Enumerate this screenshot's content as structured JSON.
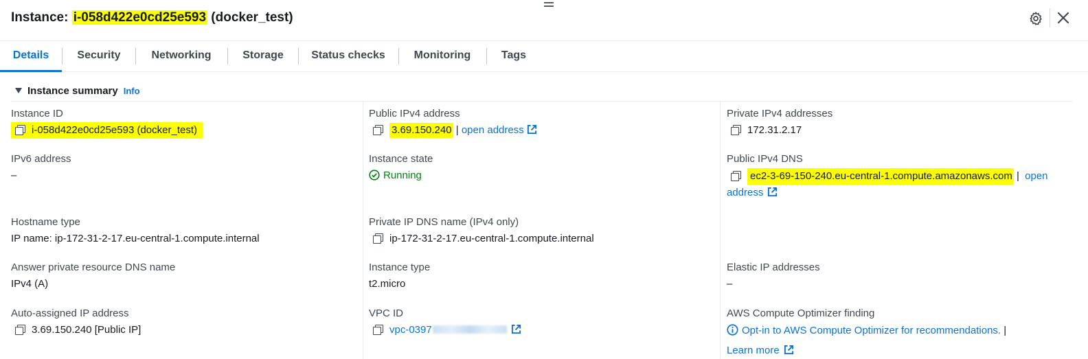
{
  "header": {
    "title_prefix": "Instance: ",
    "instance_id": "i-058d422e0cd25e593",
    "instance_name": " (docker_test)"
  },
  "tabs": [
    {
      "label": "Details",
      "active": true
    },
    {
      "label": "Security"
    },
    {
      "label": "Networking"
    },
    {
      "label": "Storage"
    },
    {
      "label": "Status checks"
    },
    {
      "label": "Monitoring"
    },
    {
      "label": "Tags"
    }
  ],
  "summary": {
    "heading": "Instance summary",
    "info": "Info"
  },
  "fields": {
    "instance_id": {
      "label": "Instance ID",
      "value": "i-058d422e0cd25e593 (docker_test)"
    },
    "ipv6": {
      "label": "IPv6 address",
      "value": "–"
    },
    "hostname_type": {
      "label": "Hostname type",
      "value": "IP name: ip-172-31-2-17.eu-central-1.compute.internal"
    },
    "answer_dns": {
      "label": "Answer private resource DNS name",
      "value": "IPv4 (A)"
    },
    "auto_ip": {
      "label": "Auto-assigned IP address",
      "value": "3.69.150.240 [Public IP]"
    },
    "public_ipv4": {
      "label": "Public IPv4 address",
      "value": "3.69.150.240",
      "sep": " | ",
      "link": "open address"
    },
    "state": {
      "label": "Instance state",
      "value": "Running"
    },
    "private_dns": {
      "label": "Private IP DNS name (IPv4 only)",
      "value": "ip-172-31-2-17.eu-central-1.compute.internal"
    },
    "instance_type": {
      "label": "Instance type",
      "value": "t2.micro"
    },
    "vpc": {
      "label": "VPC ID",
      "value": "vpc-0397"
    },
    "private_ipv4": {
      "label": "Private IPv4 addresses",
      "value": "172.31.2.17"
    },
    "public_dns": {
      "label": "Public IPv4 DNS",
      "value": "ec2-3-69-150-240.eu-central-1.compute.amazonaws.com",
      "sep": " | ",
      "link_part1": "open",
      "link_part2": "address"
    },
    "elastic_ip": {
      "label": "Elastic IP addresses",
      "value": "–"
    },
    "optimizer": {
      "label": "AWS Compute Optimizer finding",
      "link": "Opt-in to AWS Compute Optimizer for recommendations.",
      "sep": " |",
      "learn_more": "Learn more"
    }
  },
  "colors": {
    "accent": "#0972d3",
    "highlight": "#fcff00",
    "success": "#037f0c"
  },
  "icons": [
    "drag-handle-icon",
    "gear-icon",
    "close-icon",
    "copy-icon",
    "external-link-icon",
    "check-circle-icon",
    "info-icon",
    "caret-down-icon"
  ]
}
